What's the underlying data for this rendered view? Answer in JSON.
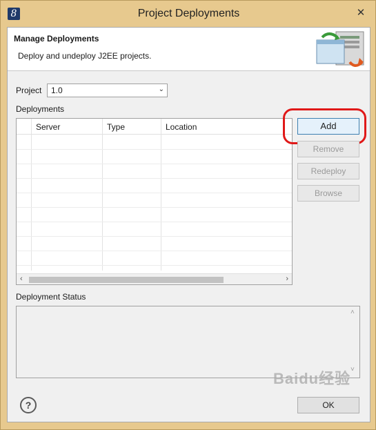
{
  "window": {
    "title": "Project Deployments",
    "close_glyph": "✕",
    "app_icon_glyph": "8"
  },
  "banner": {
    "title": "Manage Deployments",
    "description": "Deploy and undeploy J2EE projects."
  },
  "project": {
    "label": "Project",
    "selected": "1.0"
  },
  "deployments": {
    "label": "Deployments",
    "columns": [
      "Server",
      "Type",
      "Location"
    ],
    "rows": []
  },
  "buttons": {
    "add": "Add",
    "remove": "Remove",
    "redeploy": "Redeploy",
    "browse": "Browse",
    "ok": "OK"
  },
  "status": {
    "label": "Deployment Status",
    "text": ""
  },
  "icons": {
    "help": "?",
    "scroll_left": "‹",
    "scroll_right": "›",
    "scroll_up": "˄",
    "scroll_down": "˅",
    "select_arrow": "⌄"
  },
  "watermark": "Baidu经验",
  "colors": {
    "highlight": "#e01818",
    "primary_border": "#3c7fb1"
  }
}
